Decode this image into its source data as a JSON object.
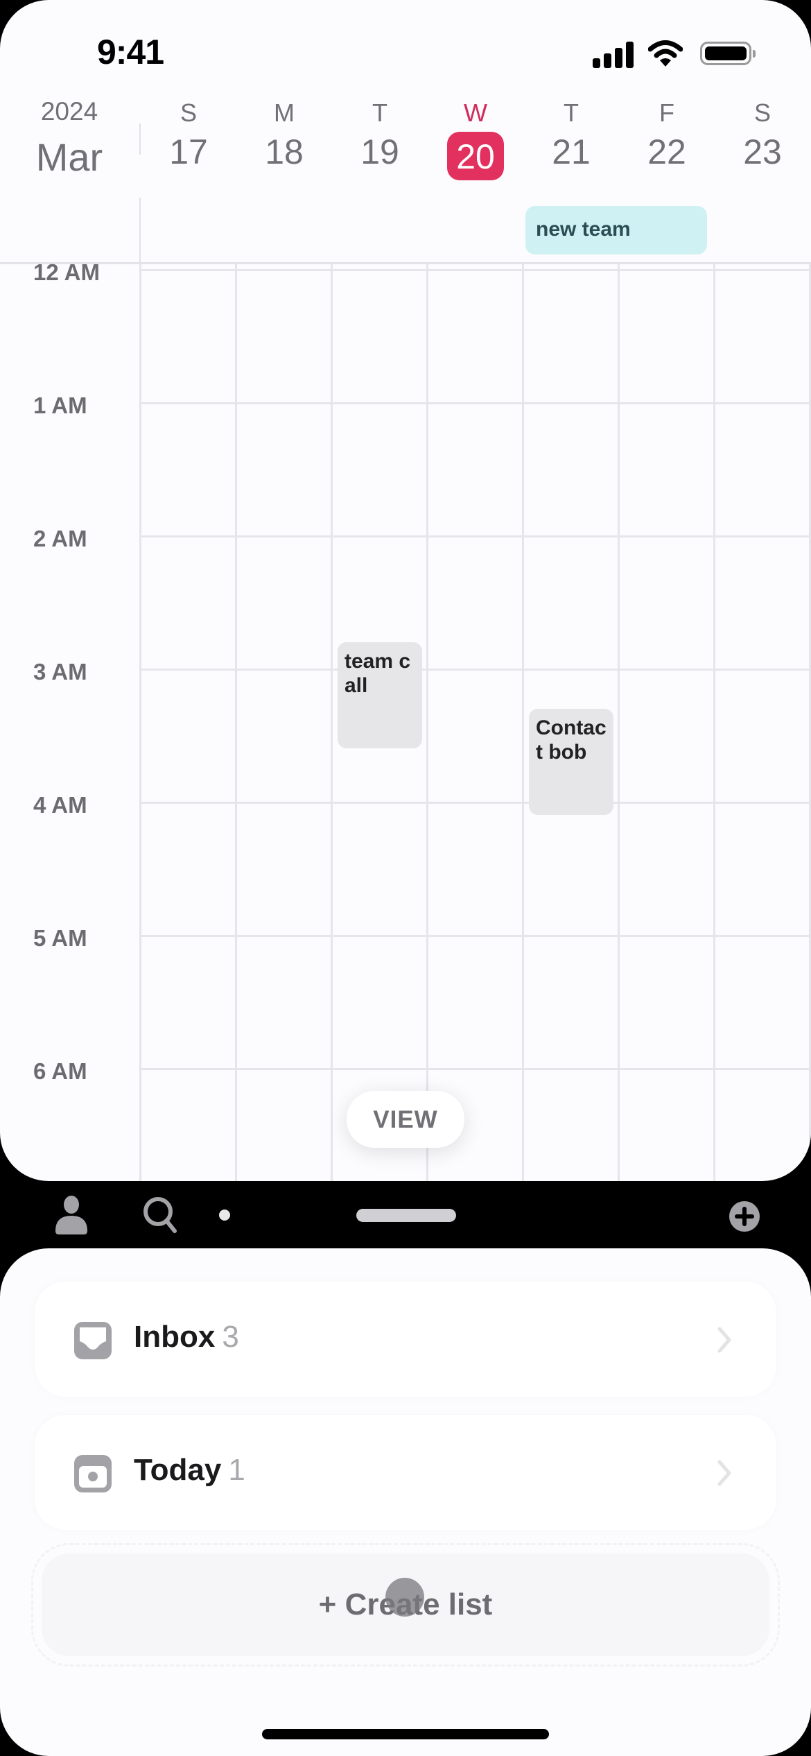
{
  "status_bar": {
    "time": "9:41",
    "icons": [
      "cellular-signal-icon",
      "wifi-icon",
      "battery-icon"
    ]
  },
  "calendar": {
    "year": "2024",
    "month": "Mar",
    "days": [
      {
        "dow": "S",
        "date": "17",
        "today": false
      },
      {
        "dow": "M",
        "date": "18",
        "today": false
      },
      {
        "dow": "T",
        "date": "19",
        "today": false
      },
      {
        "dow": "W",
        "date": "20",
        "today": true
      },
      {
        "dow": "T",
        "date": "21",
        "today": false
      },
      {
        "dow": "F",
        "date": "22",
        "today": false
      },
      {
        "dow": "S",
        "date": "23",
        "today": false
      }
    ],
    "today_color": "#e2305f",
    "all_day_events": [
      {
        "title": "new team",
        "start_day_index": 4,
        "span_days": 2,
        "color": "#cff1f4"
      }
    ],
    "hours": [
      "12 AM",
      "1 AM",
      "2 AM",
      "3 AM",
      "4 AM",
      "5 AM",
      "6 AM"
    ],
    "events": [
      {
        "title": "team call",
        "day_index": 2,
        "start_hour": 2.8,
        "end_hour": 3.6
      },
      {
        "title": "Contact bob",
        "day_index": 4,
        "start_hour": 3.3,
        "end_hour": 4.1
      }
    ],
    "view_button": "VIEW"
  },
  "toolbar": {
    "icons": [
      "profile-icon",
      "search-icon",
      "page-dot",
      "drag-handle",
      "add-circle-icon"
    ]
  },
  "lists": [
    {
      "label": "Inbox",
      "count": "3",
      "icon": "inbox-icon"
    },
    {
      "label": "Today",
      "count": "1",
      "icon": "today-icon"
    }
  ],
  "create_list_label": "+ Create list"
}
